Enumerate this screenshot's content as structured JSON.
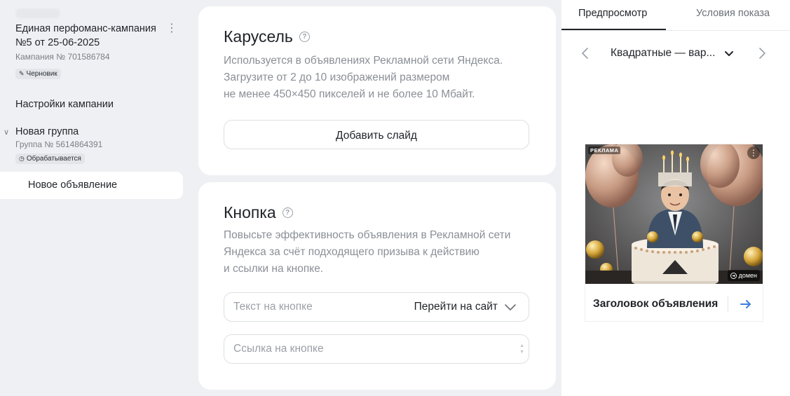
{
  "sidebar": {
    "campaign_title": "Единая перфоманс-кампания №5 от 25-06-2025",
    "campaign_number": "Кампания № 701586784",
    "campaign_status": "Черновик",
    "settings_label": "Настройки кампании",
    "group_name": "Новая группа",
    "group_number": "Группа № 5614864391",
    "group_status": "Обрабатывается",
    "ad_item": "Новое объявление"
  },
  "carousel": {
    "title": "Карусель",
    "desc_lines": [
      "Используется в объявлениях Рекламной сети Яндекса.",
      "Загрузите от 2 до 10 изображений размером",
      "не менее 450×450 пикселей и не более 10 Мбайт."
    ],
    "add_slide_label": "Добавить слайд"
  },
  "button_section": {
    "title": "Кнопка",
    "desc_lines": [
      "Повысьте эффективность объявления в Рекламной сети",
      "Яндекса за счёт подходящего призыва к действию",
      "и ссылки на кнопке."
    ],
    "text_placeholder": "Текст на кнопке",
    "text_select_value": "Перейти на сайт",
    "link_placeholder": "Ссылка на кнопке"
  },
  "preview": {
    "tabs": [
      "Предпросмотр",
      "Условия показа"
    ],
    "active_tab": 0,
    "format_label": "Квадратные — вар...",
    "ad": {
      "badge": "РЕКЛАМА",
      "domain": "домен",
      "headline": "Заголовок объявления"
    }
  },
  "colors": {
    "background": "#eff0f3",
    "card": "#ffffff",
    "text": "#1f2328",
    "muted": "#8a8f96",
    "accent_arrow": "#3d7fd9"
  },
  "icons": [
    "pencil-icon",
    "clock-icon",
    "chevron-down-icon",
    "help-icon",
    "chevron-left-icon",
    "chevron-right-icon",
    "arrow-right-icon",
    "kebab-icon"
  ]
}
